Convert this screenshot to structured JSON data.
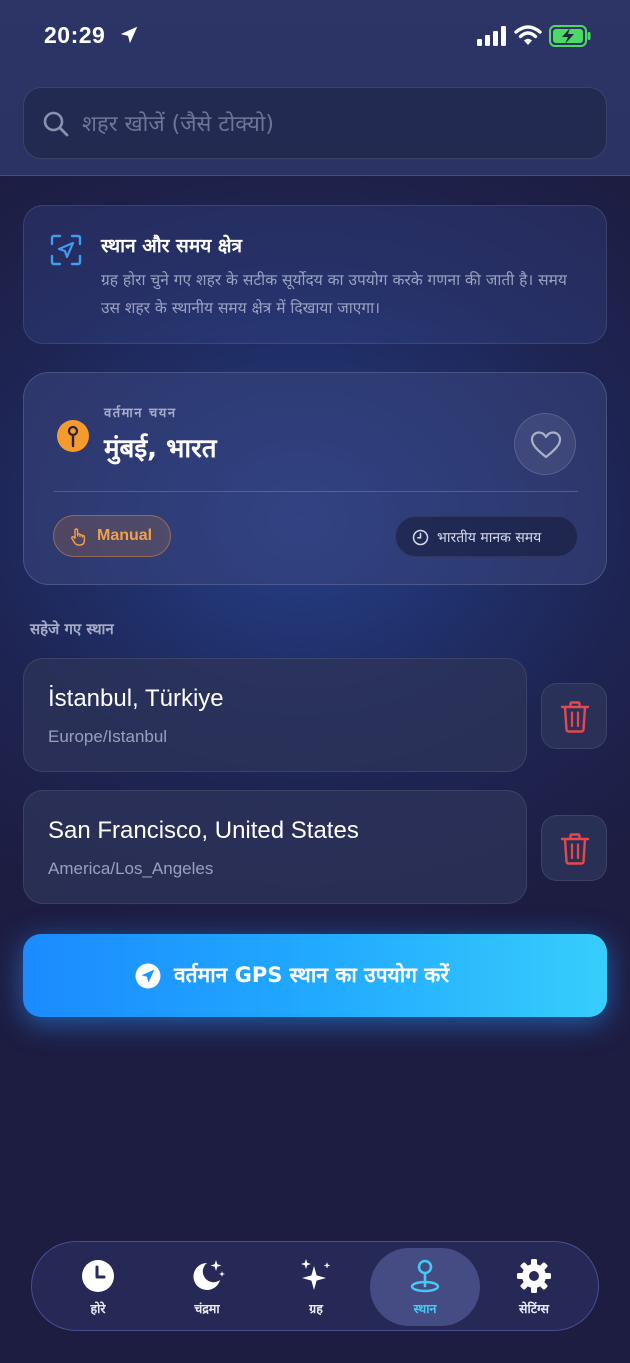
{
  "status_bar": {
    "time": "20:29"
  },
  "search": {
    "placeholder": "शहर खोजें (जैसे टोक्यो)"
  },
  "info": {
    "title": "स्थान और समय क्षेत्र",
    "description": "ग्रह होरा चुने गए शहर के सटीक सूर्योदय का उपयोग करके गणना की जाती है। समय उस शहर के स्थानीय समय क्षेत्र में दिखाया जाएगा।"
  },
  "current": {
    "label": "वर्तमान चयन",
    "city": "मुंबई, भारत",
    "mode": "Manual",
    "timezone": "भारतीय मानक समय"
  },
  "saved": {
    "title": "सहेजे गए स्थान",
    "items": [
      {
        "name": "İstanbul, Türkiye",
        "timezone": "Europe/Istanbul"
      },
      {
        "name": "San Francisco, United States",
        "timezone": "America/Los_Angeles"
      }
    ]
  },
  "gps_button": {
    "label": "वर्तमान GPS स्थान का उपयोग करें"
  },
  "tabs": [
    {
      "label": "होरे",
      "icon": "clock-icon"
    },
    {
      "label": "चंद्रमा",
      "icon": "moon-stars-icon"
    },
    {
      "label": "ग्रह",
      "icon": "sparkles-icon"
    },
    {
      "label": "स्थान",
      "icon": "location-pin-icon",
      "active": true
    },
    {
      "label": "सेटिंग्स",
      "icon": "gear-icon"
    }
  ],
  "colors": {
    "accent": "#21a9ff",
    "active_tab": "#46c9f5",
    "manual_chip": "#f0a049",
    "delete": "#e5484d",
    "pin": "#f59a2c"
  }
}
